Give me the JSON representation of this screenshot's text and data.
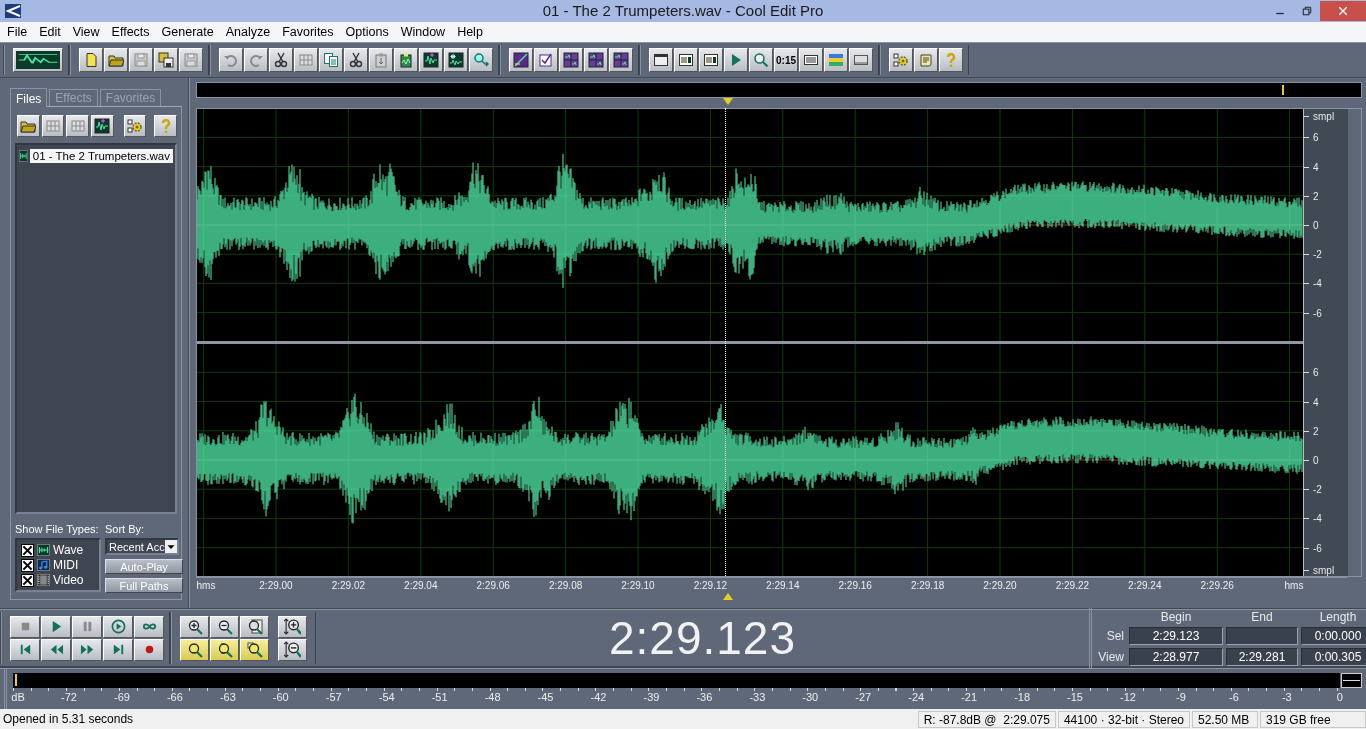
{
  "window": {
    "title": "01 - The 2 Trumpeters.wav - Cool Edit Pro"
  },
  "menu": [
    "File",
    "Edit",
    "View",
    "Effects",
    "Generate",
    "Analyze",
    "Favorites",
    "Options",
    "Window",
    "Help"
  ],
  "toolbar": {
    "time_button_label": "0:15"
  },
  "organizer": {
    "tabs": [
      {
        "label": "Files",
        "selected": true
      },
      {
        "label": "Effects",
        "selected": false
      },
      {
        "label": "Favorites",
        "selected": false
      }
    ],
    "files": [
      {
        "name": "01 - The 2 Trumpeters.wav",
        "selected": true
      }
    ],
    "show_file_types_label": "Show File Types:",
    "file_types": [
      {
        "label": "Wave",
        "checked": true,
        "kind": "wave"
      },
      {
        "label": "MIDI",
        "checked": true,
        "kind": "midi"
      },
      {
        "label": "Video",
        "checked": true,
        "kind": "video"
      }
    ],
    "sort_by_label": "Sort By:",
    "sort_by_value": "Recent Acc",
    "buttons": [
      "Auto-Play",
      "Full Paths"
    ]
  },
  "waveform": {
    "channels": [
      {
        "scale": [
          "smpl",
          "6",
          "4",
          "2",
          "0",
          "-2",
          "-4",
          "-6"
        ]
      },
      {
        "scale": [
          "6",
          "4",
          "2",
          "0",
          "-2",
          "-4",
          "-6",
          "smpl"
        ]
      }
    ],
    "time_axis": {
      "unit_left": "hms",
      "ticks": [
        "2:29.00",
        "2:29.02",
        "2:29.04",
        "2:29.06",
        "2:29.08",
        "2:29.10",
        "2:29.12",
        "2:29.14",
        "2:29.16",
        "2:29.18",
        "2:29.20",
        "2:29.22",
        "2:29.24",
        "2:29.26"
      ],
      "unit_right": "hms"
    }
  },
  "time_display": "2:29.123",
  "selection": {
    "headers": [
      "Begin",
      "End",
      "Length"
    ],
    "rows": [
      {
        "label": "Sel",
        "begin": "2:29.123",
        "length": "0:00.000"
      },
      {
        "label": "View",
        "begin": "2:28.977",
        "end": "2:29.281",
        "length": "0:00.305"
      }
    ]
  },
  "level_meter": {
    "unit": "dB",
    "ticks": [
      "-72",
      "-69",
      "-66",
      "-63",
      "-60",
      "-57",
      "-54",
      "-51",
      "-48",
      "-45",
      "-42",
      "-39",
      "-36",
      "-33",
      "-30",
      "-27",
      "-24",
      "-21",
      "-18",
      "-15",
      "-12",
      "-9",
      "-6",
      "-3",
      "0"
    ]
  },
  "status_bar": {
    "message": "Opened in 5.31 seconds",
    "fields": [
      "R: -87.8dB @  2:29.075",
      "44100 · 32-bit · Stereo",
      "52.50 MB",
      "319 GB free"
    ]
  }
}
